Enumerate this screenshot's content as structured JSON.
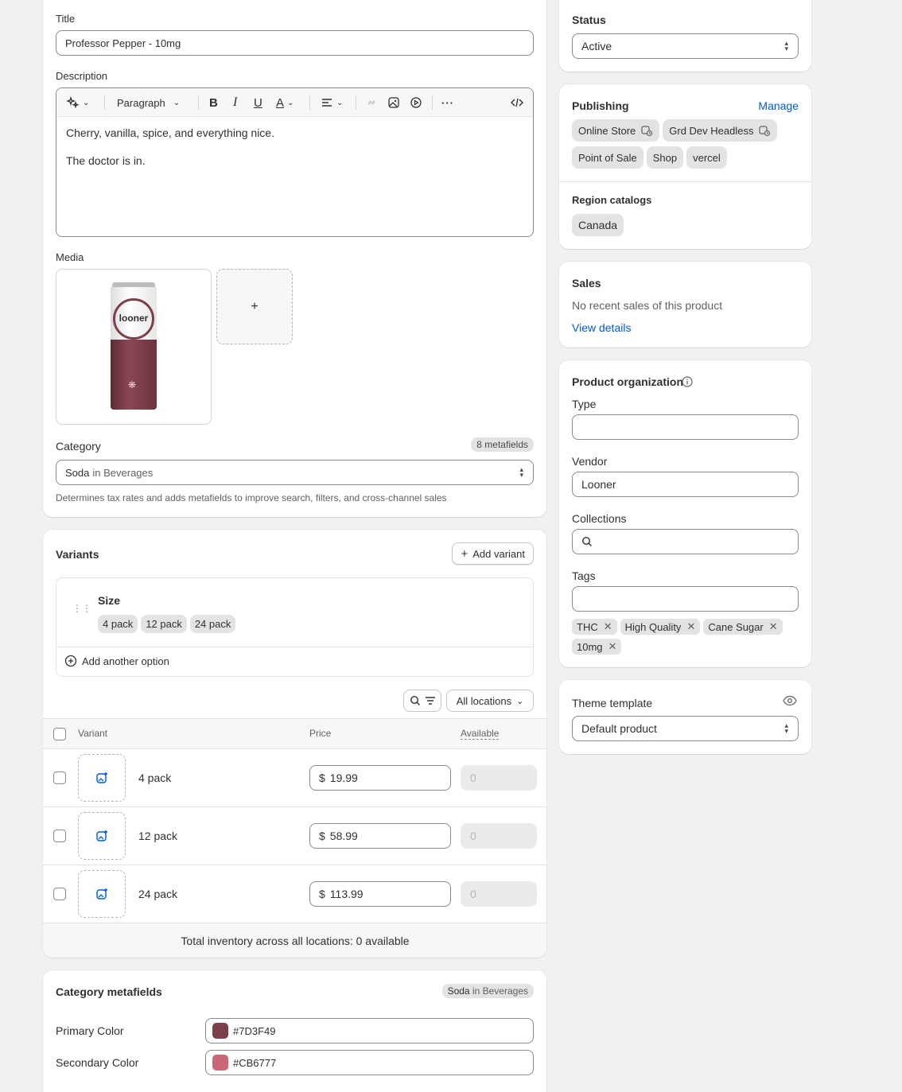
{
  "main": {
    "title_label": "Title",
    "title_value": "Professor Pepper - 10mg",
    "description_label": "Description",
    "toolbar": {
      "paragraph": "Paragraph"
    },
    "description_lines": [
      "Cherry, vanilla, spice, and everything nice.",
      "The doctor is in."
    ],
    "media_label": "Media",
    "media_add": "+",
    "can_text": "looner",
    "category_label": "Category",
    "metafields_badge": "8 metafields",
    "category_value": "Soda",
    "category_in": "in Beverages",
    "category_help": "Determines tax rates and adds metafields to improve search, filters, and cross-channel sales"
  },
  "variants": {
    "title": "Variants",
    "add_variant": "Add variant",
    "option_name": "Size",
    "option_values": [
      "4 pack",
      "12 pack",
      "24 pack"
    ],
    "add_another_option": "Add another option",
    "locations": "All locations",
    "columns": {
      "variant": "Variant",
      "price": "Price",
      "available": "Available"
    },
    "rows": [
      {
        "name": "4 pack",
        "currency": "$",
        "price": "19.99",
        "available": "0"
      },
      {
        "name": "12 pack",
        "currency": "$",
        "price": "58.99",
        "available": "0"
      },
      {
        "name": "24 pack",
        "currency": "$",
        "price": "113.99",
        "available": "0"
      }
    ],
    "total_inventory": "Total inventory across all locations: 0 available"
  },
  "category_metafields": {
    "title": "Category metafields",
    "badge_strong": "Soda",
    "badge_rest": "in Beverages",
    "fields": [
      {
        "label": "Primary Color",
        "value": "#7D3F49",
        "swatch": "#7D3F49"
      },
      {
        "label": "Secondary Color",
        "value": "#CB6777",
        "swatch": "#CB6777"
      }
    ]
  },
  "sidebar": {
    "status_label": "Status",
    "status_value": "Active",
    "publishing_label": "Publishing",
    "manage": "Manage",
    "channels": [
      "Online Store",
      "Grd Dev Headless",
      "Point of Sale",
      "Shop",
      "vercel"
    ],
    "region_label": "Region catalogs",
    "region": "Canada",
    "sales_label": "Sales",
    "sales_text": "No recent sales of this product",
    "view_details": "View details",
    "org_label": "Product organization",
    "type_label": "Type",
    "type_value": "",
    "vendor_label": "Vendor",
    "vendor_value": "Looner",
    "collections_label": "Collections",
    "tags_label": "Tags",
    "tags": [
      "THC",
      "High Quality",
      "Cane Sugar",
      "10mg"
    ],
    "theme_label": "Theme template",
    "theme_value": "Default product"
  },
  "colors": {
    "accent": "#005bd3",
    "can_top": "#ffffff",
    "can_bottom": "#7d3f49"
  }
}
